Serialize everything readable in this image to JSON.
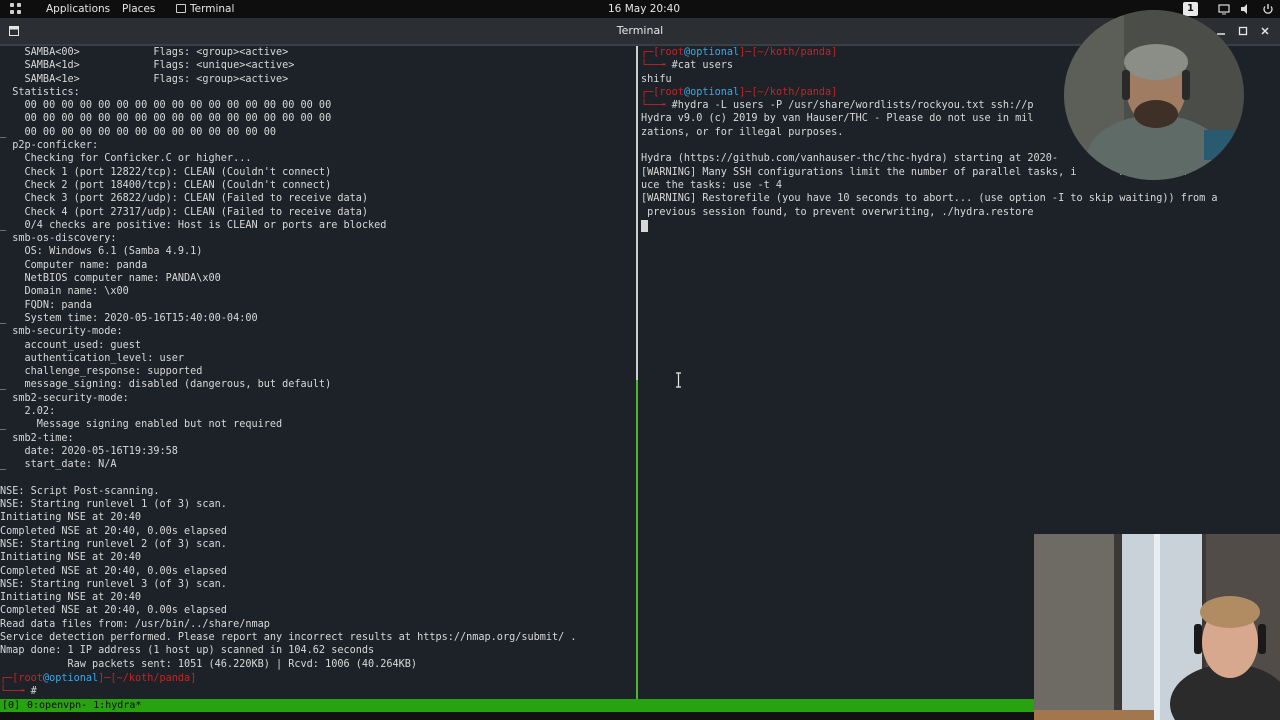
{
  "topbar": {
    "applications": "Applications",
    "places": "Places",
    "terminal": "Terminal",
    "datetime": "16 May 20:40",
    "workspace": "1"
  },
  "window": {
    "title": "Terminal"
  },
  "left_pane": {
    "lines": [
      "    SAMBA<00>            Flags: <group><active>",
      "    SAMBA<1d>            Flags: <unique><active>",
      "    SAMBA<1e>            Flags: <group><active>",
      "  Statistics:",
      "    00 00 00 00 00 00 00 00 00 00 00 00 00 00 00 00 00",
      "    00 00 00 00 00 00 00 00 00 00 00 00 00 00 00 00 00",
      "_   00 00 00 00 00 00 00 00 00 00 00 00 00 00",
      "  p2p-conficker:",
      "    Checking for Conficker.C or higher...",
      "    Check 1 (port 12822/tcp): CLEAN (Couldn't connect)",
      "    Check 2 (port 18400/tcp): CLEAN (Couldn't connect)",
      "    Check 3 (port 26822/udp): CLEAN (Failed to receive data)",
      "    Check 4 (port 27317/udp): CLEAN (Failed to receive data)",
      "_   0/4 checks are positive: Host is CLEAN or ports are blocked",
      "  smb-os-discovery:",
      "    OS: Windows 6.1 (Samba 4.9.1)",
      "    Computer name: panda",
      "    NetBIOS computer name: PANDA\\x00",
      "    Domain name: \\x00",
      "    FQDN: panda",
      "_   System time: 2020-05-16T15:40:00-04:00",
      "  smb-security-mode:",
      "    account_used: guest",
      "    authentication_level: user",
      "    challenge_response: supported",
      "_   message_signing: disabled (dangerous, but default)",
      "  smb2-security-mode:",
      "    2.02:",
      "_     Message signing enabled but not required",
      "  smb2-time:",
      "    date: 2020-05-16T19:39:58",
      "_   start_date: N/A",
      "",
      "NSE: Script Post-scanning.",
      "NSE: Starting runlevel 1 (of 3) scan.",
      "Initiating NSE at 20:40",
      "Completed NSE at 20:40, 0.00s elapsed",
      "NSE: Starting runlevel 2 (of 3) scan.",
      "Initiating NSE at 20:40",
      "Completed NSE at 20:40, 0.00s elapsed",
      "NSE: Starting runlevel 3 (of 3) scan.",
      "Initiating NSE at 20:40",
      "Completed NSE at 20:40, 0.00s elapsed",
      "Read data files from: /usr/bin/../share/nmap",
      "Service detection performed. Please report any incorrect results at https://nmap.org/submit/ .",
      "Nmap done: 1 IP address (1 host up) scanned in 104.62 seconds",
      "           Raw packets sent: 1051 (46.220KB) | Rcvd: 1006 (40.264KB)"
    ],
    "prompt_user": "root",
    "prompt_host": "optional",
    "prompt_path": "~/koth/panda"
  },
  "right_pane": {
    "prompt_user": "root",
    "prompt_host": "optional",
    "prompt_path": "~/koth/panda",
    "cmd1": "#cat users",
    "out1": "shifu",
    "cmd2": "#hydra -L users -P /usr/share/wordlists/rockyou.txt ssh://p",
    "out_lines": [
      "Hydra v9.0 (c) 2019 by van Hauser/THC - Please do not use in mil                  ganiz",
      "zations, or for illegal purposes.",
      "",
      "Hydra (https://github.com/vanhauser-thc/thc-hydra) starting at 2020-",
      "[WARNING] Many SSH configurations limit the number of parallel tasks, i       nded to red",
      "uce the tasks: use -t 4",
      "[WARNING] Restorefile (you have 10 seconds to abort... (use option -I to skip waiting)) from a",
      " previous session found, to prevent overwriting, ./hydra.restore"
    ]
  },
  "tmux": {
    "session": "[0]",
    "windows": "0:openvpn- 1:hydra*"
  },
  "colors": {
    "terminal_bg": "#1c2228",
    "prompt_red": "#c02626",
    "prompt_blue": "#3da7e8",
    "tmux_green": "#27a30f",
    "active_pane_border": "#4fb52a"
  },
  "icons": [
    "apps-grid-icon",
    "terminal-icon",
    "workspace-indicator",
    "window-menu-icon",
    "minimize-icon",
    "maximize-icon",
    "close-icon",
    "text-cursor-icon"
  ]
}
